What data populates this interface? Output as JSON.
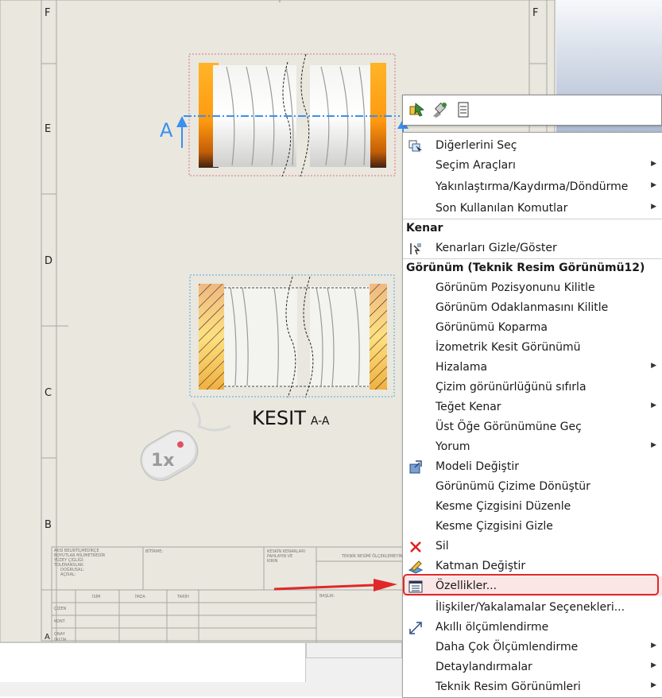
{
  "drawing": {
    "zones": [
      "F",
      "E",
      "D",
      "C",
      "B",
      "A"
    ],
    "section_label": "A",
    "section_title": "KESIT",
    "section_subtitle": "A-A",
    "mouse_hint": "1x",
    "title_block": {
      "row_labels": [
        "ÇİZEN",
        "KONT",
        "ONAY",
        "ÜRETİM"
      ],
      "col_labels": [
        "İSİM",
        "İMZA",
        "TARİH"
      ],
      "right_label": "BAŞLIK:",
      "notes_left": [
        "AKSİ BELİRTİLMEDİKÇE",
        "BOYUTLAR MİLİMETREDİR",
        "YÜZEY ÇİĞLİĞİ:",
        "TOLERANSLAR:",
        "DOĞRUSAL:",
        "AÇISAL:"
      ],
      "notes_mid": "BİTİRME:",
      "notes_mid2": [
        "KESKİN KENARLARI",
        "PAHLAYIN VE",
        "KIRIN"
      ],
      "notes_right": "TEKNİK RESİMİ ÖLÇEKLEMEYİN"
    }
  },
  "mini_toolbar": {
    "buttons": [
      "select-icon",
      "edit-feature-icon",
      "properties-list-icon"
    ]
  },
  "context_menu": {
    "items_top": [
      {
        "label": "Diğerlerini Seç",
        "icon": "select-other-icon",
        "submenu": false
      },
      {
        "label": "Seçim Araçları",
        "submenu": true
      },
      {
        "label": "Yakınlaştırma/Kaydırma/Döndürme",
        "submenu": true
      },
      {
        "label": "Son Kullanılan Komutlar",
        "submenu": true
      }
    ],
    "header_edge": "Kenar",
    "items_edge": [
      {
        "label": "Kenarları Gizle/Göster",
        "icon": "hide-show-edges-icon"
      }
    ],
    "header_view": "Görünüm (Teknik Resim Görünümü12)",
    "items_view": [
      {
        "label": "Görünüm Pozisyonunu Kilitle",
        "submenu": false
      },
      {
        "label": "Görünüm Odaklanmasını Kilitle",
        "submenu": false
      },
      {
        "label": "Görünümü Koparma",
        "submenu": false
      },
      {
        "label": "İzometrik Kesit Görünümü",
        "submenu": false
      },
      {
        "label": "Hizalama",
        "submenu": true
      },
      {
        "label": "Çizim görünürlüğünü sıfırla",
        "submenu": false
      },
      {
        "label": "Teğet Kenar",
        "submenu": true
      },
      {
        "label": "Üst Öğe Görünümüne Geç",
        "submenu": false
      },
      {
        "label": "Yorum",
        "submenu": true
      },
      {
        "label": "Modeli Değiştir",
        "icon": "replace-model-icon",
        "submenu": false
      },
      {
        "label": "Görünümü Çizime Dönüştür",
        "submenu": false
      },
      {
        "label": "Kesme Çizgisini Düzenle",
        "submenu": false
      },
      {
        "label": "Kesme Çizgisini Gizle",
        "submenu": false
      },
      {
        "label": "Sil",
        "icon": "delete-icon",
        "submenu": false
      },
      {
        "label": "Katman Değiştir",
        "icon": "change-layer-icon",
        "submenu": false
      },
      {
        "label": "Özellikler...",
        "icon": "properties-icon",
        "submenu": false,
        "highlighted": true
      },
      {
        "label": "İlişkiler/Yakalamalar Seçenekleri...",
        "submenu": false
      },
      {
        "label": "Akıllı ölçümlendirme",
        "icon": "smart-dimension-icon",
        "submenu": false
      },
      {
        "label": "Daha Çok Ölçümlendirme",
        "submenu": true
      },
      {
        "label": "Detaylandırmalar",
        "submenu": true
      },
      {
        "label": "Teknik Resim Görünümleri",
        "submenu": true
      }
    ],
    "accent": "#e0282a"
  },
  "colors": {
    "sheet": "#e9e7de",
    "border_lines": "#c8c8c8",
    "section_blue": "#3b8ff0",
    "callout_red": "#e0282a"
  }
}
